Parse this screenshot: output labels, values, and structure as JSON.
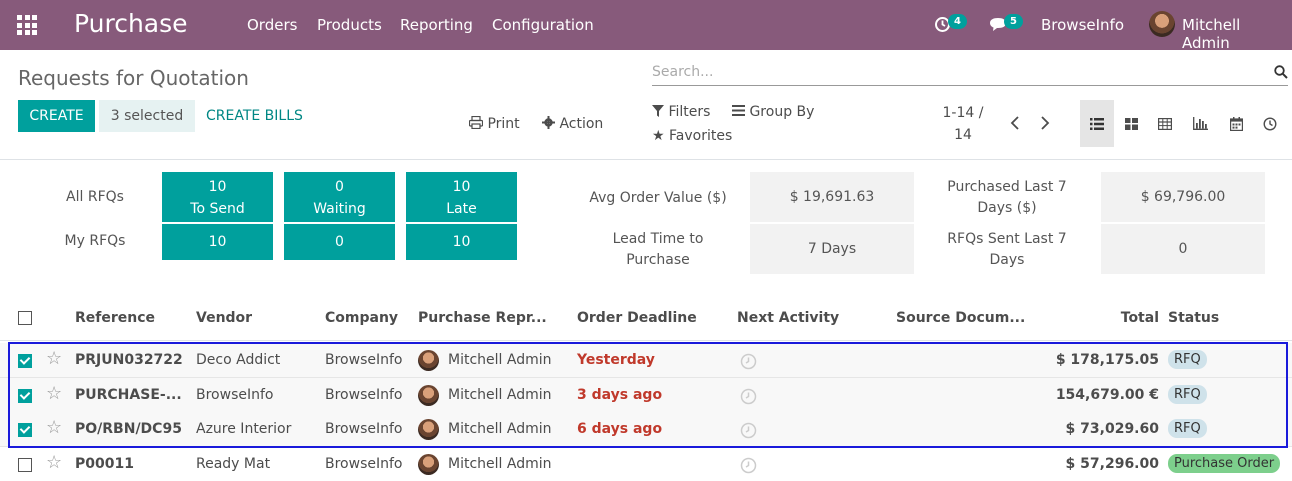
{
  "navbar": {
    "app_name": "Purchase",
    "menu": [
      "Orders",
      "Products",
      "Reporting",
      "Configuration"
    ],
    "activity_count": "4",
    "message_count": "5",
    "company": "BrowseInfo",
    "user": "Mitchell Admin"
  },
  "control_panel": {
    "title": "Requests for Quotation",
    "create_label": "CREATE",
    "selected_label": "3 selected",
    "create_bills_label": "CREATE BILLS",
    "print_label": "Print",
    "action_label": "Action",
    "search_placeholder": "Search...",
    "filters_label": "Filters",
    "groupby_label": "Group By",
    "favorites_label": "Favorites",
    "pager_range": "1-14 /",
    "pager_total": "14"
  },
  "dashboard": {
    "all_rfqs_label": "All RFQs",
    "my_rfqs_label": "My RFQs",
    "tiles": [
      {
        "all_value": "10",
        "all_caption": "To Send",
        "my_value": "10"
      },
      {
        "all_value": "0",
        "all_caption": "Waiting",
        "my_value": "0"
      },
      {
        "all_value": "10",
        "all_caption": "Late",
        "my_value": "10"
      }
    ],
    "stats": {
      "avg_order_label": "Avg Order Value ($)",
      "avg_order_value": "$ 19,691.63",
      "purchased_label": "Purchased Last 7 Days ($)",
      "purchased_value": "$ 69,796.00",
      "lead_time_label": "Lead Time to Purchase",
      "lead_time_value": "7  Days",
      "rfqs_sent_label": "RFQs Sent Last 7 Days",
      "rfqs_sent_value": "0"
    }
  },
  "table": {
    "columns": [
      "Reference",
      "Vendor",
      "Company",
      "Purchase Repr...",
      "Order Deadline",
      "Next Activity",
      "Source Docum...",
      "Total",
      "Status"
    ],
    "rows": [
      {
        "reference": "PRJUN032722",
        "vendor": "Deco Addict",
        "company": "BrowseInfo",
        "rep": "Mitchell Admin",
        "deadline": "Yesterday",
        "total": "$ 178,175.05",
        "status": "RFQ",
        "selected": true
      },
      {
        "reference": "PURCHASE-...",
        "vendor": "BrowseInfo",
        "company": "BrowseInfo",
        "rep": "Mitchell Admin",
        "deadline": "3 days ago",
        "total": "154,679.00 €",
        "status": "RFQ",
        "selected": true
      },
      {
        "reference": "PO/RBN/DC95",
        "vendor": "Azure Interior",
        "company": "BrowseInfo",
        "rep": "Mitchell Admin",
        "deadline": "6 days ago",
        "total": "$ 73,029.60",
        "status": "RFQ",
        "selected": true
      },
      {
        "reference": "P00011",
        "vendor": "Ready Mat",
        "company": "BrowseInfo",
        "rep": "Mitchell Admin",
        "deadline": "",
        "total": "$ 57,296.00",
        "status": "Purchase Order",
        "selected": false
      }
    ]
  },
  "colors": {
    "navbar": "#875a7b",
    "accent": "#00a09d",
    "overdue": "#c0392b",
    "selection_frame": "#1a1adb"
  },
  "icons": [
    "apps-grid-icon",
    "activity-clock-icon",
    "chat-bubble-icon",
    "print-icon",
    "gear-icon",
    "search-icon",
    "filter-icon",
    "list-icon",
    "star-icon",
    "chevron-left-icon",
    "chevron-right-icon",
    "list-view-icon",
    "kanban-view-icon",
    "pivot-view-icon",
    "graph-view-icon",
    "calendar-view-icon",
    "activity-view-icon"
  ]
}
